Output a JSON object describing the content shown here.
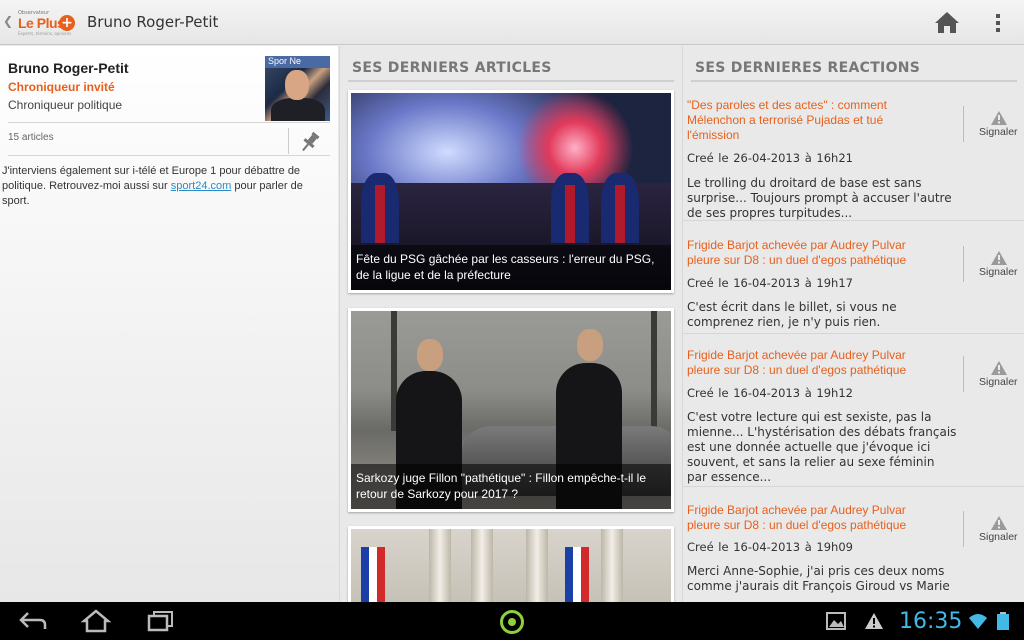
{
  "action_bar": {
    "logo_small": "Observateur",
    "logo_main": "Le Plus",
    "logo_plus": "+",
    "logo_tagline": "Experts, témoins, opinions",
    "title": "Bruno Roger-Petit",
    "up_icon": "chevron-left-icon",
    "home_icon": "home-icon",
    "overflow_icon": "overflow-menu-icon"
  },
  "author": {
    "name": "Bruno Roger-Petit",
    "role": "Chroniqueur invité",
    "subtitle": "Chroniqueur politique",
    "avatar_sign": "Spor Ne",
    "article_count": "15 articles",
    "bio_before": "J'interviens également sur i-télé et Europe 1 pour débattre de politique. Retrouvez-moi aussi sur ",
    "bio_link": "sport24.com",
    "bio_after": " pour parler de sport."
  },
  "articles": {
    "heading": "SES DERNIERS ARTICLES",
    "items": [
      {
        "caption": "Fête du PSG gâchée par les casseurs : l'erreur du PSG, de la ligue et de la préfecture"
      },
      {
        "caption": "Sarkozy juge Fillon \"pathétique\" : Fillon empêche-t-il le retour de Sarkozy pour 2017 ?"
      },
      {
        "caption": ""
      }
    ]
  },
  "reactions": {
    "heading": "SES DERNIERES REACTIONS",
    "signal_label": "Signaler",
    "items": [
      {
        "title": "\"Des paroles et des actes\" : comment Mélenchon a terrorisé Pujadas et tué l'émission",
        "date": "Creé le 26-04-2013  à  16h21",
        "body": "Le trolling du droitard de base est sans surprise... Toujours prompt à accuser l'autre de ses propres turpitudes..."
      },
      {
        "title": "Frigide Barjot achevée par Audrey Pulvar pleure sur D8 : un duel d'egos pathétique",
        "date": "Creé le 16-04-2013  à  19h17",
        "body": "C'est écrit dans le billet, si vous ne comprenez rien, je n'y puis rien."
      },
      {
        "title": "Frigide Barjot achevée par Audrey Pulvar pleure sur D8 : un duel d'egos pathétique",
        "date": "Creé le 16-04-2013  à  19h12",
        "body": "C'est votre lecture qui est sexiste, pas la mienne... L'hystérisation des débats français est une donnée actuelle que j'évoque ici souvent, et sans la relier au sexe féminin par essence..."
      },
      {
        "title": "Frigide Barjot achevée par Audrey Pulvar pleure sur D8 : un duel d'egos pathétique",
        "date": "Creé le 16-04-2013  à  19h09",
        "body": "Merci Anne-Sophie, j'ai pris ces deux noms comme j'aurais dit François Giroud vs Marie"
      }
    ]
  },
  "system_bar": {
    "clock": "16:35",
    "icons": [
      "back-icon",
      "home-icon",
      "recent-apps-icon",
      "launcher-icon",
      "gallery-icon",
      "warning-icon",
      "wifi-icon",
      "battery-icon"
    ]
  },
  "colors": {
    "accent_orange": "#e8601c",
    "link_blue": "#2a8ac8",
    "clock_blue": "#43b9e6",
    "launcher_green": "#8fd13a"
  }
}
